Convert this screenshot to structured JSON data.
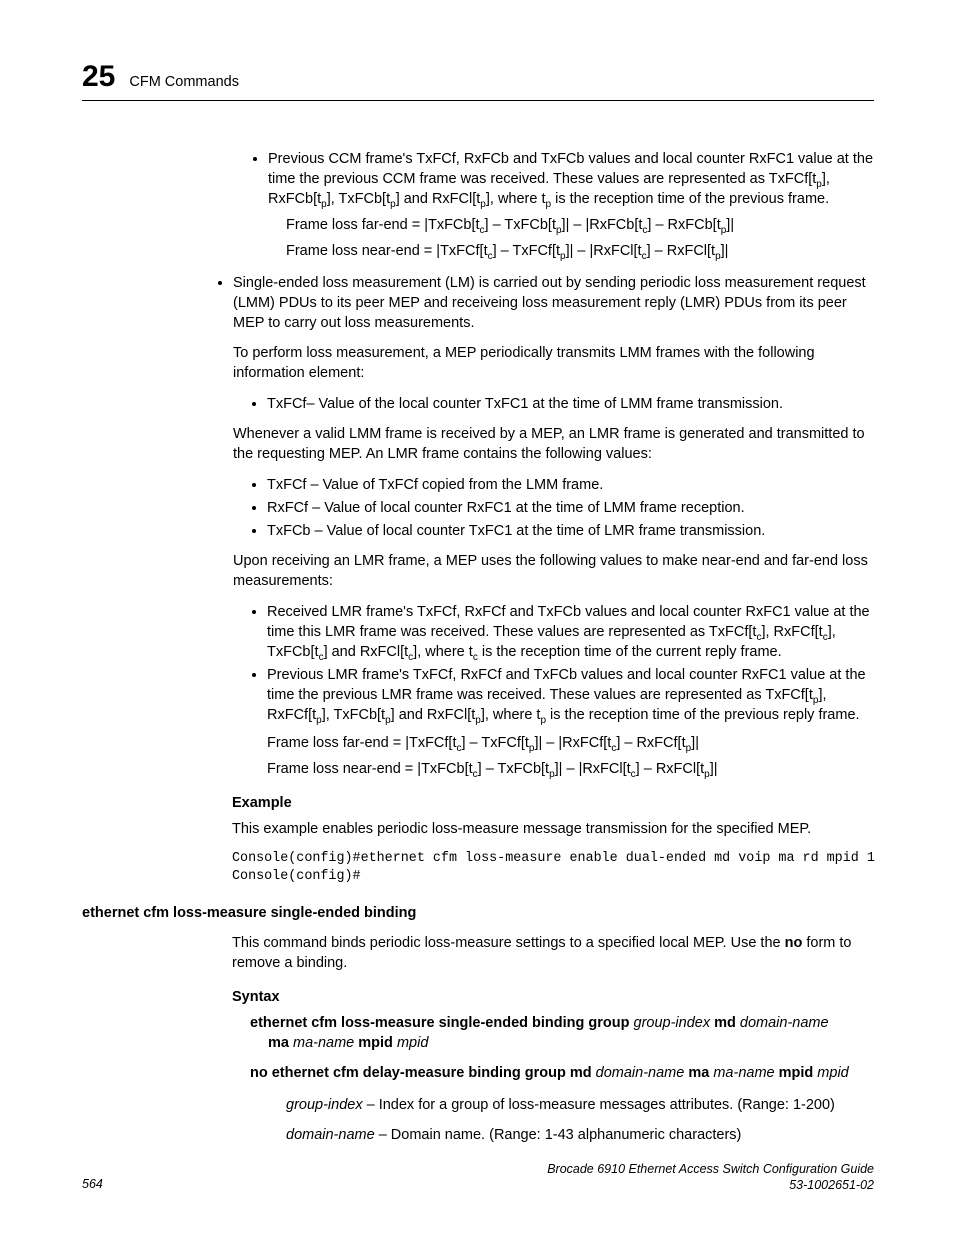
{
  "header": {
    "chapnum": "25",
    "chaptitle": "CFM Commands"
  },
  "body": {
    "b1": "Previous CCM frame's TxFCf, RxFCb and TxFCb values and local counter RxFC1 value at the time the previous CCM frame was received. These values are represented as TxFCf[t",
    "b1b": "], RxFCb[t",
    "b1c": "], TxFCb[t",
    "b1d": "] and RxFCl[t",
    "b1e": "], where t",
    "b1f": " is the reception time of the previous frame.",
    "f1a": "Frame loss far-end = |TxFCb[t",
    "f1b": "] – TxFCb[t",
    "f1c": "]|  –  |RxFCb[t",
    "f1d": "] – RxFCb[t",
    "f1e": "]|",
    "f2a": "Frame loss near-end = |TxFCf[t",
    "f2b": "] – TxFCf[t",
    "f2c": "]|  –  |RxFCl[t",
    "f2d": "] – RxFCl[t",
    "f2e": "]|",
    "single": "Single-ended loss measurement (LM) is carried out by sending periodic loss measurement request (LMM) PDUs to its peer MEP and receiveing loss measurement reply (LMR) PDUs from its peer MEP to carry out loss measurements.",
    "perform": "To perform loss measurement, a MEP periodically transmits LMM frames with the following information element:",
    "txfcf1": "TxFCf– Value of the local counter TxFC1 at the time of LMM frame transmission.",
    "whenever": "Whenever a valid LMM frame is received by a MEP, an LMR frame is generated and transmitted to the requesting MEP. An LMR frame contains the following values:",
    "li_a": "TxFCf – Value of TxFCf copied from the LMM frame.",
    "li_b": "RxFCf – Value of local counter RxFC1 at the time of LMM frame reception.",
    "li_c": "TxFCb – Value of local counter TxFC1 at the time of LMR frame transmission.",
    "upon": "Upon receiving an LMR frame, a MEP uses the following values to make near-end and far-end loss measurements:",
    "r1a": "Received LMR frame's TxFCf, RxFCf and TxFCb values and local counter RxFC1 value at the time this LMR frame was received. These values are represented as TxFCf[t",
    "r1b": "], RxFCf[t",
    "r1c": "], TxFCb[t",
    "r1d": "] and RxFCl[t",
    "r1e": "], where t",
    "r1f": " is the reception time of the current reply frame.",
    "r2a": "Previous LMR frame's TxFCf, RxFCf and TxFCb values and local counter RxFC1 value at the time the previous LMR frame was received. These values are represented as TxFCf[t",
    "r2b": "], RxFCf[t",
    "r2c": "], TxFCb[t",
    "r2d": "] and RxFCl[t",
    "r2e": "], where t",
    "r2f": " is the reception time of the previous reply frame.",
    "g1a": "Frame loss far-end = |TxFCf[t",
    "g1b": "] – TxFCf[t",
    "g1c": "]|  –  |RxFCf[t",
    "g1d": "] – RxFCf[t",
    "g1e": "]|",
    "g2a": "Frame loss near-end = |TxFCb[t",
    "g2b": "] – TxFCb[t",
    "g2c": "]|  –  |RxFCl[t",
    "g2d": "] – RxFCl[t",
    "g2e": "]|",
    "example_h": "Example",
    "example_p": "This example enables periodic loss-measure message transmission for the specified MEP.",
    "code": "Console(config)#ethernet cfm loss-measure enable dual-ended md voip ma rd mpid 1\nConsole(config)#",
    "cmd_title": "ethernet cfm loss-measure single-ended binding",
    "cmd_desc1": "This command binds periodic loss-measure settings to a specified local MEP. Use the ",
    "cmd_desc_no": "no",
    "cmd_desc2": " form to remove a binding.",
    "syntax_h": "Syntax",
    "syn1_a": "ethernet cfm loss-measure single-ended binding group",
    "syn1_b": "group-index",
    "syn1_c": "md",
    "syn1_d": "domain-name",
    "syn1_e": "ma",
    "syn1_f": "ma-name",
    "syn1_g": "mpid",
    "syn1_h": "mpid",
    "syn2_a": "no ethernet cfm delay-measure binding group md",
    "syn2_b": "domain-name",
    "syn2_c": "ma",
    "syn2_d": "ma-name",
    "syn2_e": "mpid",
    "syn2_f": "mpid",
    "param1_a": "group-index",
    "param1_b": " – Index for a group of loss-measure messages attributes. (Range: 1-200)",
    "param2_a": "domain-name",
    "param2_b": " – Domain name. (Range: 1-43 alphanumeric characters)",
    "sub_c": "c",
    "sub_p": "p"
  },
  "footer": {
    "pnum": "564",
    "line1": "Brocade 6910 Ethernet Access Switch Configuration Guide",
    "line2": "53-1002651-02"
  }
}
